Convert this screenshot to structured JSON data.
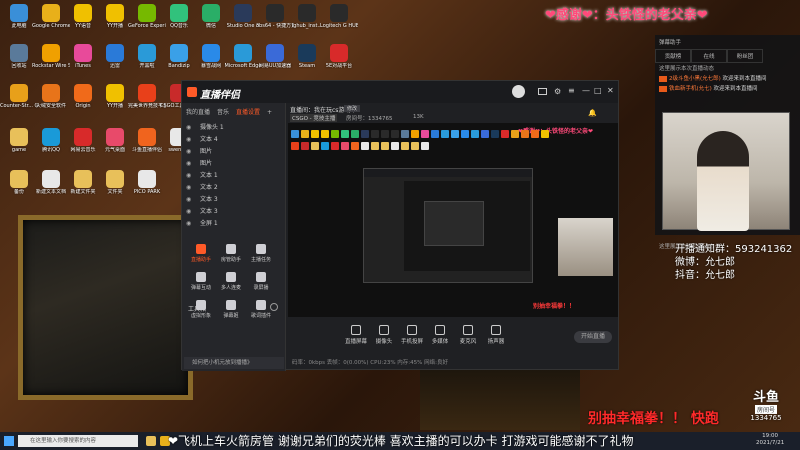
{
  "desktop_icons": [
    {
      "label": "此电脑",
      "color": "#3a8fd8"
    },
    {
      "label": "Google Chrome",
      "color": "#e8b01a"
    },
    {
      "label": "YY语音",
      "color": "#f0c000"
    },
    {
      "label": "YY开播",
      "color": "#f0c000"
    },
    {
      "label": "GeForce Experience",
      "color": "#76b900"
    },
    {
      "label": "QQ音乐",
      "color": "#31c27c"
    },
    {
      "label": "微信",
      "color": "#2aae67"
    },
    {
      "label": "Studio One 3",
      "color": "#2a3a5a"
    },
    {
      "label": "obs64 - 快捷方式",
      "color": "#2a2a2a"
    },
    {
      "label": "lghub_inst...",
      "color": "#2a2a2a"
    },
    {
      "label": "Logitech G HUB",
      "color": "#2a2a2a"
    },
    {
      "label": "回收站",
      "color": "#5a7a9a"
    },
    {
      "label": "Rockstar Wire Sound",
      "color": "#f0a000"
    },
    {
      "label": "iTunes",
      "color": "#e84a9a"
    },
    {
      "label": "迅雷",
      "color": "#2a7ad8"
    },
    {
      "label": "开黑啦",
      "color": "#2a9ad8"
    },
    {
      "label": "Bandizip",
      "color": "#3aa0e8"
    },
    {
      "label": "暴雪战网",
      "color": "#2a8ae8"
    },
    {
      "label": "Microsoft Edge",
      "color": "#2a9ad8"
    },
    {
      "label": "网易UU加速器",
      "color": "#3a6ad8"
    },
    {
      "label": "Steam",
      "color": "#1a3a5a"
    },
    {
      "label": "5E对战平台",
      "color": "#d82a2a"
    },
    {
      "label": "Counter-Str... Global Off...",
      "color": "#e8a01a"
    },
    {
      "label": "火绒安全软件",
      "color": "#e8741a"
    },
    {
      "label": "Origin",
      "color": "#f06a1a"
    },
    {
      "label": "YY开播",
      "color": "#f0c000"
    },
    {
      "label": "完美世界竞技平台",
      "color": "#e8401a"
    },
    {
      "label": "CSGO工具箱 1.0.1 (1)",
      "color": "#c82a2a"
    },
    {
      "label": "game",
      "color": "#e8c05a"
    },
    {
      "label": "腾讯QQ",
      "color": "#1a9ad8"
    },
    {
      "label": "网易云音乐",
      "color": "#d82a2a"
    },
    {
      "label": "元气桌面",
      "color": "#e84a6a"
    },
    {
      "label": "斗鱼直播伴侣",
      "color": "#f0641e"
    },
    {
      "label": "swencky",
      "color": "#e8e8e8"
    },
    {
      "label": "zhaopian",
      "color": "#e8c05a"
    },
    {
      "label": "备份",
      "color": "#e8c05a"
    },
    {
      "label": "新建文本文档",
      "color": "#e8e8e8"
    },
    {
      "label": "新建文件夹",
      "color": "#e8c05a"
    },
    {
      "label": "文件夹",
      "color": "#e8c05a"
    },
    {
      "label": "PICO PARK",
      "color": "#e8e8e8"
    }
  ],
  "overlay": {
    "thanks_top": "❤感谢❤：头铁怪的老父亲❤",
    "ticker_bottom": "❤飞机上车火箭房管 谢谢兄弟们的荧光棒 喜欢主播的可以办卡 打游戏可能感谢不了礼物",
    "draw_banner": "别抽幸福拳！！ 快跑",
    "social_lines": [
      "开播通知群：593241362",
      "微博：允七郎",
      "抖音：允七郎"
    ],
    "watermark": "斗鱼",
    "watermark_sub": "房间号",
    "room_number": "1334765"
  },
  "app": {
    "brand": "直播伴侣",
    "brand_color": "#ff5a28",
    "tabs": [
      "我的直播",
      "音乐",
      "直播设置",
      "+"
    ],
    "active_tab": 2,
    "scenes": [
      "摄像头 1",
      "文本 4",
      "图片",
      "图片",
      "文本 1",
      "文本 2",
      "文本 3",
      "文本 3",
      "全屏 1"
    ],
    "tools_title": "工具箱",
    "tools": [
      {
        "label": "直播助手",
        "active": true
      },
      {
        "label": "房管助手",
        "active": false
      },
      {
        "label": "主播任务",
        "active": false
      },
      {
        "label": "弹幕互动",
        "active": false
      },
      {
        "label": "多人连麦",
        "active": false
      },
      {
        "label": "录屏播",
        "active": false
      },
      {
        "label": "虚拟形象",
        "active": false
      },
      {
        "label": "弹幕姬",
        "active": false
      },
      {
        "label": "歌词插件",
        "active": false
      }
    ],
    "notice": "如何把小机元放到播播》",
    "stream_title": "直播间：我在玩cs游戏中",
    "stream_tag": "修改",
    "game_category": "CSGO - 竞技主播",
    "room_info": "房间号：1334765",
    "followers": "13K",
    "chat_overlay_thanks": "❤感谢❤：头铁怪的老父亲❤",
    "controls": [
      {
        "label": "直播屏幕"
      },
      {
        "label": "摄像头"
      },
      {
        "label": "手机投屏"
      },
      {
        "label": "多媒体"
      },
      {
        "label": "麦克风"
      },
      {
        "label": "扬声器"
      }
    ],
    "start_button": "开始直播",
    "status_text": "码率：0kbps   丢帧：0(0.00%)   CPU:23%   内存:45%   网络:良好",
    "preview_side_text": "别抽幸福拳！！"
  },
  "chat_panel": {
    "title": "弹幕助手",
    "tabs": [
      "贡献榜",
      "在线",
      "粉丝团"
    ],
    "notice": "这里展示本次直播动态",
    "lines": [
      {
        "user": "2级斗鱼小黑(允七郎)",
        "text": "欢迎来到本直播间"
      },
      {
        "user": "铁血新手机(允七)",
        "text": "欢迎来到本直播间"
      }
    ],
    "footer": "这里展示本次直播动态"
  },
  "taskbar": {
    "search_placeholder": "在这里输入你要搜索的内容",
    "time": "19:00",
    "date": "2021/7/21"
  }
}
